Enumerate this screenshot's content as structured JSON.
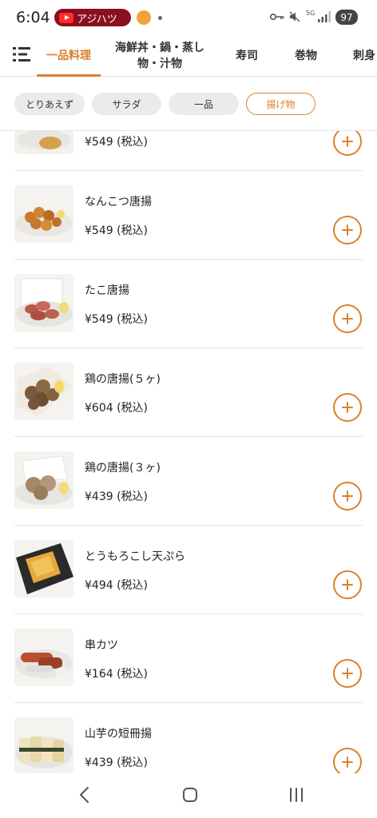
{
  "status_bar": {
    "time": "6:04",
    "youtube_label": "アジハツ",
    "network_label": "5G",
    "battery": "97",
    "icons": [
      "youtube-icon",
      "app-notification-icon",
      "key-icon",
      "mute-icon",
      "signal-icon"
    ]
  },
  "tabs": [
    {
      "label": "一品料理",
      "active": true
    },
    {
      "label_line1": "海鮮丼・鍋・蒸し",
      "label_line2": "物・汁物",
      "active": false
    },
    {
      "label": "寿司",
      "active": false
    },
    {
      "label": "巻物",
      "active": false
    },
    {
      "label": "刺身",
      "active": false
    }
  ],
  "chips": [
    {
      "label": "とりあえず",
      "selected": false
    },
    {
      "label": "サラダ",
      "selected": false
    },
    {
      "label": "一品",
      "selected": false
    },
    {
      "label": "揚げ物",
      "selected": true
    }
  ],
  "items": [
    {
      "name": "",
      "price": "¥549 (税込)"
    },
    {
      "name": "なんこつ唐揚",
      "price": "¥549 (税込)"
    },
    {
      "name": "たこ唐揚",
      "price": "¥549 (税込)"
    },
    {
      "name": "鶏の唐揚(５ヶ)",
      "price": "¥604 (税込)"
    },
    {
      "name": "鶏の唐揚(３ヶ)",
      "price": "¥439 (税込)"
    },
    {
      "name": "とうもろこし天ぷら",
      "price": "¥494 (税込)"
    },
    {
      "name": "串カツ",
      "price": "¥164 (税込)"
    },
    {
      "name": "山芋の短冊揚",
      "price": "¥439 (税込)"
    }
  ],
  "colors": {
    "accent": "#d9822b",
    "chip_bg": "#ebebeb",
    "divider": "#e3e3e3"
  },
  "nav": {
    "icons": [
      "back-icon",
      "home-icon",
      "recents-icon"
    ]
  }
}
